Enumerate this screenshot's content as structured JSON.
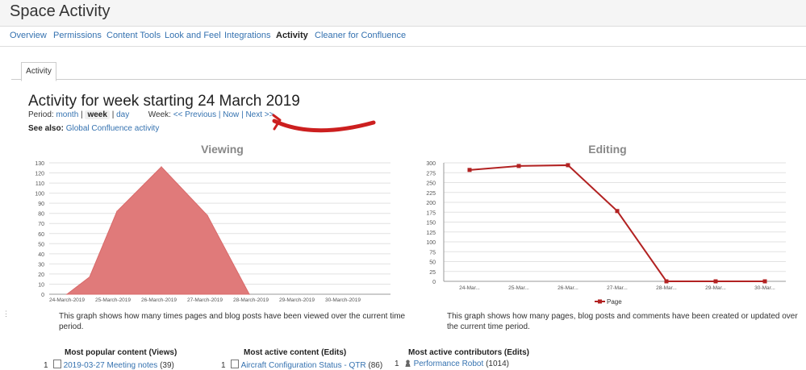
{
  "app": {
    "title": "Space Activity"
  },
  "nav": [
    {
      "label": "Overview"
    },
    {
      "label": "Permissions"
    },
    {
      "label": "Content Tools"
    },
    {
      "label": "Look and Feel"
    },
    {
      "label": "Integrations"
    },
    {
      "label": "Activity",
      "active": true
    },
    {
      "label": "Cleaner for Confluence"
    }
  ],
  "tab": {
    "label": "Activity"
  },
  "heading": "Activity for week starting 24 March 2019",
  "period": {
    "label": "Period:",
    "month": "month",
    "week": "week",
    "day": "day",
    "week_label": "Week:",
    "previous": "<< Previous",
    "now": "Now",
    "next": "Next >>"
  },
  "see_also": {
    "label": "See also:",
    "link": "Global Confluence activity"
  },
  "annotation": {
    "color": "#cc1f1f",
    "shape": "hand-drawn-arrow"
  },
  "viewing": {
    "title": "Viewing",
    "caption": "This graph shows how many times pages and blog posts have been viewed over the current time period."
  },
  "editing": {
    "title": "Editing",
    "caption": "This graph shows how many pages, blog posts and comments have been created or updated over the current time period."
  },
  "chart_data": [
    {
      "type": "area",
      "title": "Viewing",
      "categories": [
        "24-March-2019",
        "25-March-2019",
        "26-March-2019",
        "27-March-2019",
        "28-March-2019",
        "29-March-2019",
        "30-March-2019"
      ],
      "x": [
        "24-March-2019",
        "24-March-2019",
        "25-March-2019",
        "26-March-2019",
        "27-March-2019",
        "28-March-2019"
      ],
      "values": [
        0,
        17,
        82,
        126,
        78,
        0
      ],
      "ylim": [
        0,
        130
      ],
      "yticks": [
        0,
        10,
        20,
        30,
        40,
        50,
        60,
        70,
        80,
        90,
        100,
        110,
        120,
        130
      ],
      "color": "#e07a7a",
      "grid": true
    },
    {
      "type": "line",
      "title": "Editing",
      "categories": [
        "24-Mar...",
        "25-Mar...",
        "26-Mar...",
        "27-Mar...",
        "28-Mar...",
        "29-Mar...",
        "30-Mar..."
      ],
      "series": [
        {
          "name": "Page",
          "values": [
            282,
            292,
            294,
            178,
            0,
            0,
            0
          ]
        }
      ],
      "ylim": [
        0,
        300
      ],
      "yticks": [
        0,
        25,
        50,
        75,
        100,
        125,
        150,
        175,
        200,
        225,
        250,
        275,
        300
      ],
      "color": "#b22222",
      "grid": true,
      "legend": "bottom"
    }
  ],
  "bottom": {
    "popular": {
      "title": "Most popular content (Views)",
      "rank": "1",
      "item": "2019-03-27 Meeting notes",
      "count": "(39)"
    },
    "active": {
      "title": "Most active content (Edits)",
      "rank": "1",
      "item": "Aircraft Configuration Status - QTR",
      "count": "(86)"
    },
    "contributors": {
      "title": "Most active contributors (Edits)",
      "rank": "1",
      "item": "Performance Robot",
      "count": "(1014)"
    }
  }
}
